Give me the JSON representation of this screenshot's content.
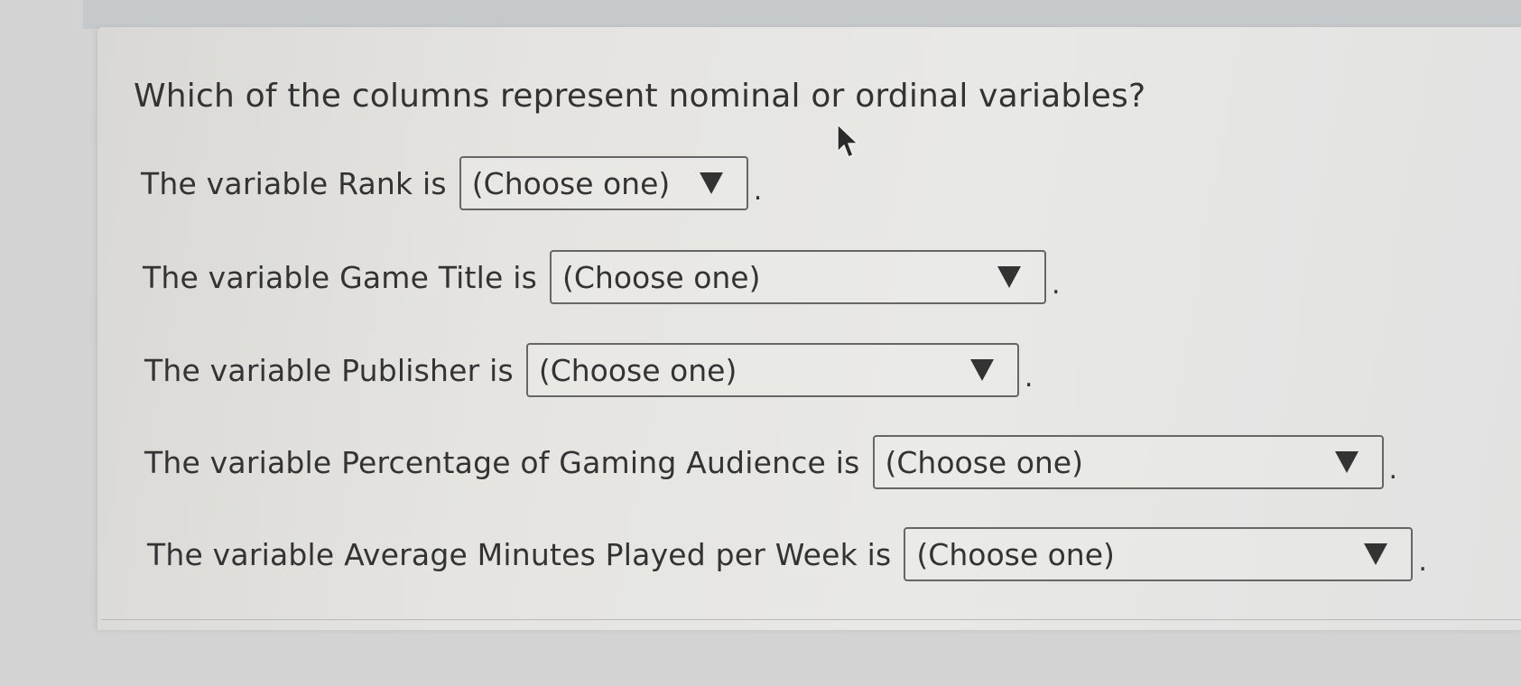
{
  "question": "Which of the columns represent nominal or ordinal variables?",
  "rows": [
    {
      "label": "The variable Rank is",
      "selected": "(Choose one)",
      "suffix": "."
    },
    {
      "label": "The variable Game Title is",
      "selected": "(Choose one)",
      "suffix": "."
    },
    {
      "label": "The variable Publisher is",
      "selected": "(Choose one)",
      "suffix": "."
    },
    {
      "label": "The variable Percentage of Gaming Audience is",
      "selected": "(Choose one)",
      "suffix": "."
    },
    {
      "label": "The variable Average Minutes Played per Week is",
      "selected": "(Choose one)",
      "suffix": "."
    }
  ],
  "icons": {
    "dropdown": "triangle-down-icon",
    "cursor": "mouse-pointer-icon"
  }
}
